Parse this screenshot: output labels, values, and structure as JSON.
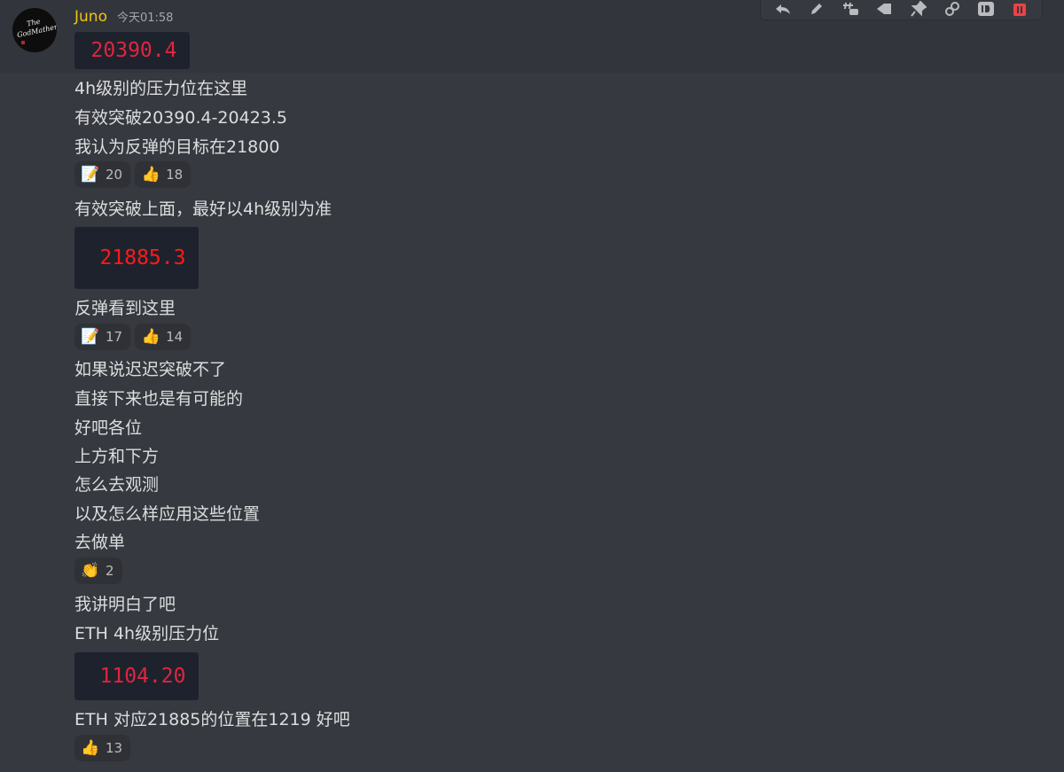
{
  "message": {
    "author": "Juno",
    "timestamp": "今天01:58",
    "avatar": {
      "text_line1": "The",
      "text_line2": "GodMather"
    }
  },
  "toolbar": {
    "icons": [
      "reply-icon",
      "edit-icon",
      "create-thread-icon",
      "reaction-icon",
      "pin-icon",
      "copy-link-icon",
      "copy-id-icon",
      "delete-icon"
    ],
    "accent_danger": "#ed4245"
  },
  "content": {
    "price1": "20390.4",
    "line1": "4h级别的压力位在这里",
    "line2": "有效突破20390.4-20423.5",
    "line3": "我认为反弹的目标在21800",
    "reactions1": [
      {
        "icon": "memo-emoji",
        "glyph": "📝",
        "count": "20"
      },
      {
        "icon": "thumbs-up-emoji",
        "glyph": "👍",
        "count": "18"
      }
    ],
    "line4": "有效突破上面，最好以4h级别为准",
    "price2": "21885.3",
    "line5": "反弹看到这里",
    "reactions2": [
      {
        "icon": "memo-emoji",
        "glyph": "📝",
        "count": "17"
      },
      {
        "icon": "thumbs-up-emoji",
        "glyph": "👍",
        "count": "14"
      }
    ],
    "line6": "如果说迟迟突破不了",
    "line7": "直接下来也是有可能的",
    "line8": "好吧各位",
    "line9": "上方和下方",
    "line10": "怎么去观测",
    "line11": "以及怎么样应用这些位置",
    "line12": "去做单",
    "reactions3": [
      {
        "icon": "clapping-hands-emoji",
        "glyph": "👏",
        "count": "2"
      }
    ],
    "line13": "我讲明白了吧",
    "line14": "ETH 4h级别压力位",
    "price3": "1104.20",
    "line15": "ETH 对应21885的位置在1219 好吧",
    "reactions4": [
      {
        "icon": "thumbs-up-emoji",
        "glyph": "👍",
        "count": "13"
      }
    ]
  },
  "colors": {
    "background": "#36393f",
    "author": "#f1c40f",
    "price_red": "#e0253f",
    "price_bright_red": "#ff1a1a"
  }
}
